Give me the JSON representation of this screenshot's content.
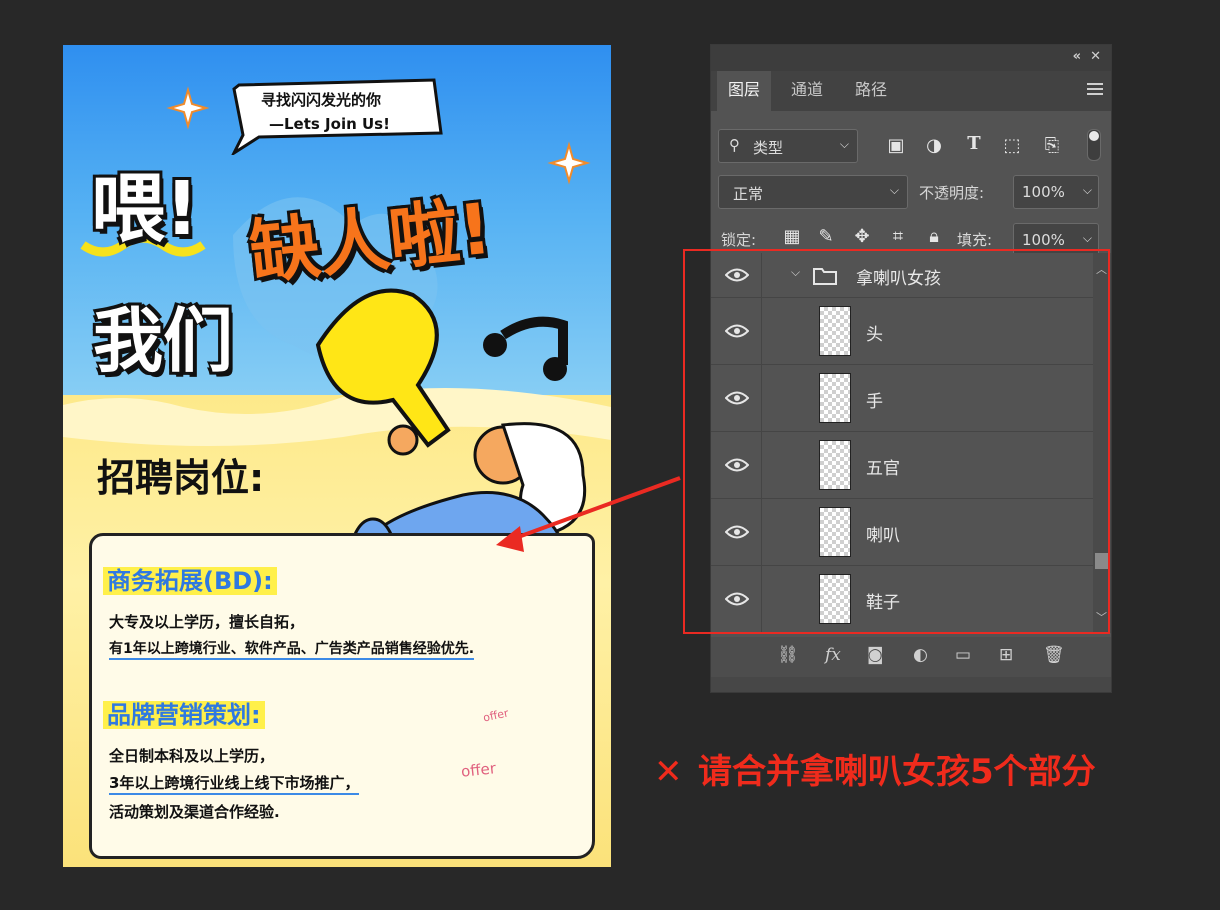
{
  "poster": {
    "speech_bubble": {
      "line1": "寻找闪闪发光的你",
      "line2": "—Lets Join Us!"
    },
    "headline": {
      "part1": "喂!",
      "part2": "缺人啦!",
      "part3": "我们"
    },
    "recruit_title": "招聘岗位:",
    "position1": {
      "title": "商务拓展(BD):",
      "line1": "大专及以上学历，擅长自拓，",
      "line2": "有1年以上跨境行业、软件产品、广告类产品销售经验优先."
    },
    "position2": {
      "title": "品牌营销策划:",
      "line1": "全日制本科及以上学历，",
      "line2": "3年以上跨境行业线上线下市场推广，",
      "line3": "活动策划及渠道合作经验."
    },
    "envelope_label": "offer",
    "colors": {
      "sky": "#2f8ff0",
      "sand": "#fde98a",
      "accent_orange": "#f7741b",
      "title_blue": "#2f79e0",
      "highlight_yellow": "#fff04a"
    }
  },
  "panel": {
    "tabs": [
      "图层",
      "通道",
      "路径"
    ],
    "active_tab": "图层",
    "filter_kind": "类型",
    "blend_mode": "正常",
    "opacity_label": "不透明度:",
    "opacity_value": "100%",
    "lock_label": "锁定:",
    "fill_label": "填充:",
    "fill_value": "100%",
    "group": {
      "name": "拿喇叭女孩",
      "expanded": true
    },
    "layers": [
      {
        "name": "头",
        "visible": true
      },
      {
        "name": "手",
        "visible": true
      },
      {
        "name": "五官",
        "visible": true
      },
      {
        "name": "喇叭",
        "visible": true
      },
      {
        "name": "鞋子",
        "visible": true
      }
    ],
    "filter_icons": [
      "image-icon",
      "adjustment-icon",
      "type-icon",
      "shape-icon",
      "smart-object-icon"
    ],
    "lock_icons": [
      "lock-pixels-icon",
      "lock-paint-icon",
      "lock-move-icon",
      "lock-artboard-icon",
      "lock-all-icon"
    ],
    "bottom_icons": [
      "link-icon",
      "fx-icon",
      "mask-icon",
      "adjustment-layer-icon",
      "folder-icon",
      "new-layer-icon",
      "trash-icon"
    ]
  },
  "annotation": {
    "note": "请合并拿喇叭女孩5个部分",
    "mark": "✕",
    "colors": {
      "red": "#ea2a22"
    }
  }
}
